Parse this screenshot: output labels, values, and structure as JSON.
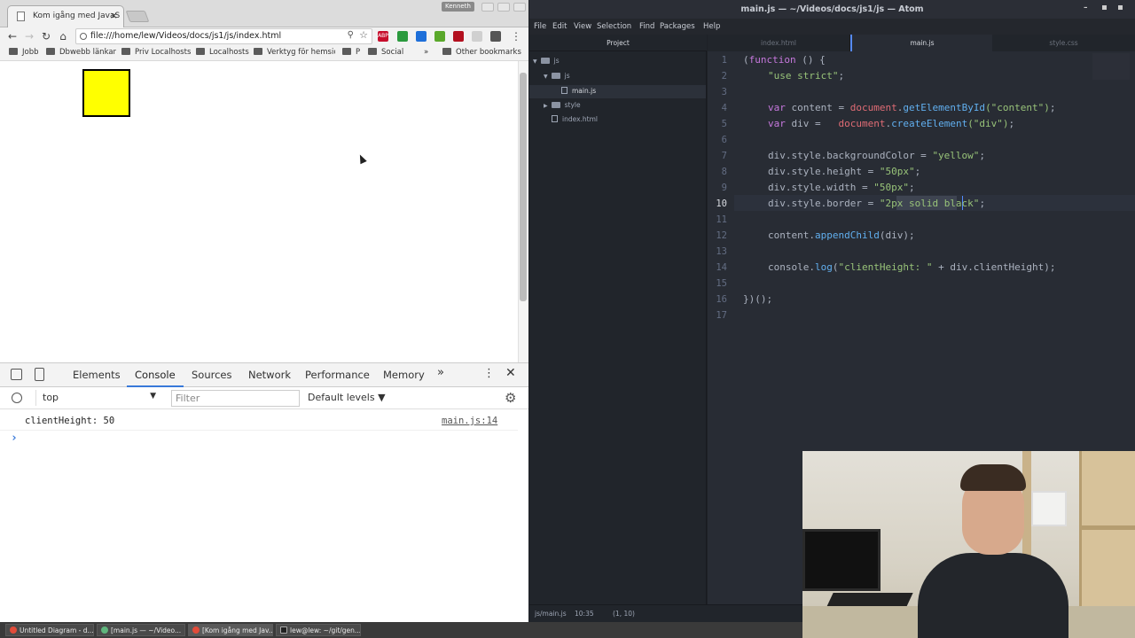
{
  "chrome": {
    "tabs": [
      {
        "label": "Kom igång med JavaS",
        "active": true
      },
      {
        "label": "",
        "active": false
      }
    ],
    "close_glyph": "×",
    "user_badge": "Kenneth",
    "url": "file:///home/lew/Videos/docs/js1/js/index.html",
    "bookmarks": [
      "Jobb",
      "Dbwebb länkar",
      "Priv Localhosts",
      "Localhosts",
      "Verktyg för hemsic",
      "P",
      "Social"
    ],
    "bookmarks_overflow": "»",
    "other_bookmarks": "Other bookmarks",
    "page_box_color": "#ffff00",
    "extensions": [
      {
        "name": "abp-icon",
        "label": "ABP",
        "color": "#c70d2c"
      },
      {
        "name": "green-ext-icon",
        "label": "",
        "color": "#2b9a3e"
      },
      {
        "name": "dropper-icon",
        "label": "",
        "color": "#1e6fd9"
      },
      {
        "name": "grammar-ext-icon",
        "label": "",
        "color": "#5aa82b"
      },
      {
        "name": "ublock-icon",
        "label": "",
        "color": "#b3101f"
      },
      {
        "name": "blank-ext-icon",
        "label": "",
        "color": "#d0d0d0"
      },
      {
        "name": "globe-ext-icon",
        "label": "",
        "color": "#555"
      }
    ]
  },
  "devtools": {
    "tabs": [
      "Elements",
      "Console",
      "Sources",
      "Network",
      "Performance",
      "Memory"
    ],
    "active_tab": "Console",
    "more": "»",
    "context": "top",
    "filter_placeholder": "Filter",
    "levels": "Default levels ▼",
    "messages": [
      {
        "text": "clientHeight: 50",
        "source": "main.js:14"
      }
    ],
    "prompt": "›"
  },
  "atom": {
    "title": "main.js — ~/Videos/docs/js1/js — Atom",
    "menu": [
      "File",
      "Edit",
      "View",
      "Selection",
      "Find",
      "Packages",
      "Help"
    ],
    "tree_header": "Project",
    "tree": [
      {
        "label": "js",
        "type": "root"
      },
      {
        "label": "js",
        "type": "folder-open"
      },
      {
        "label": "main.js",
        "type": "file",
        "selected": true
      },
      {
        "label": "style",
        "type": "folder"
      },
      {
        "label": "index.html",
        "type": "file"
      }
    ],
    "editor_tabs": [
      "index.html",
      "main.js",
      "style.css"
    ],
    "active_editor_tab": "main.js",
    "line_numbers": [
      "1",
      "2",
      "3",
      "4",
      "5",
      "6",
      "7",
      "8",
      "9",
      "10",
      "11",
      "12",
      "13",
      "14",
      "15",
      "16",
      "17"
    ],
    "current_line": "10",
    "code": {
      "l1_a": "(",
      "l1_kw": "function",
      "l1_b": " () {",
      "l2": "\"use strict\"",
      "l2_end": ";",
      "l4_kw": "var",
      "l4_a": " content = ",
      "l4_obj": "document",
      "l4_dot": ".",
      "l4_fn": "getElementById",
      "l4_arg": "(\"content\")",
      "l4_end": ";",
      "l5_kw": "var",
      "l5_a": " div =   ",
      "l5_obj": "document",
      "l5_dot": ".",
      "l5_fn": "createElement",
      "l5_arg": "(\"div\")",
      "l5_end": ";",
      "l7_a": "div.style.backgroundColor = ",
      "l7_s": "\"yellow\"",
      "l7_end": ";",
      "l8_a": "div.style.height = ",
      "l8_s": "\"50px\"",
      "l8_end": ";",
      "l9_a": "div.style.width = ",
      "l9_s": "\"50px\"",
      "l9_end": ";",
      "l10_a": "div.style.border = ",
      "l10_s": "\"2px solid black\"",
      "l10_end": ";",
      "l12_a": "content.",
      "l12_fn": "appendChild",
      "l12_b": "(div);",
      "l14_a": "console.",
      "l14_fn": "log",
      "l14_b": "(",
      "l14_s": "\"clientHeight: \"",
      "l14_c": " + div.clientHeight);",
      "l16": "})();"
    },
    "status": {
      "path": "js/main.js",
      "time": "10:35",
      "cursor": "(1, 10)"
    }
  },
  "taskbar": [
    {
      "label": "Untitled Diagram - d...",
      "icon": "chrome-icon",
      "color": "#e24c3a"
    },
    {
      "label": "[main.js — ~/Video...",
      "icon": "atom-icon",
      "color": "#5fb57d"
    },
    {
      "label": "[Kom igång med Jav...",
      "icon": "chrome-icon",
      "color": "#e24c3a"
    },
    {
      "label": "lew@lew: ~/git/gen...",
      "icon": "terminal-icon",
      "color": "#222"
    }
  ]
}
